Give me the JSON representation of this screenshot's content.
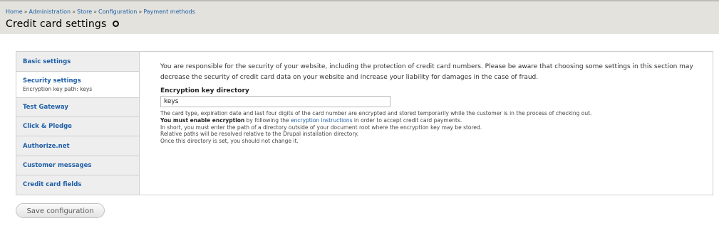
{
  "breadcrumb": {
    "items": [
      "Home",
      "Administration",
      "Store",
      "Configuration",
      "Payment methods"
    ],
    "separator": "»"
  },
  "page": {
    "title": "Credit card settings",
    "title_icon": "gear-icon"
  },
  "vertical_tabs": [
    {
      "label": "Basic settings",
      "summary": ""
    },
    {
      "label": "Security settings",
      "summary": "Encryption key path: keys",
      "active": true
    },
    {
      "label": "Test Gateway",
      "summary": ""
    },
    {
      "label": "Click & Pledge",
      "summary": ""
    },
    {
      "label": "Authorize.net",
      "summary": ""
    },
    {
      "label": "Customer messages",
      "summary": ""
    },
    {
      "label": "Credit card fields",
      "summary": ""
    }
  ],
  "security": {
    "intro": "You are responsible for the security of your website, including the protection of credit card numbers. Please be aware that choosing some settings in this section may decrease the security of credit card data on your website and increase your liability for damages in the case of fraud.",
    "field_label": "Encryption key directory",
    "field_value": "keys",
    "desc_line1": "The card type, expiration date and last four digits of the card number are encrypted and stored temporarily while the customer is in the process of checking out.",
    "desc_strong": "You must enable encryption",
    "desc_mid": " by following the ",
    "desc_link": "encryption instructions",
    "desc_end": " in order to accept credit card payments.",
    "desc_line3": "In short, you must enter the path of a directory outside of your document root where the encryption key may be stored.",
    "desc_line4": "Relative paths will be resolved relative to the Drupal installation directory.",
    "desc_line5": "Once this directory is set, you should not change it."
  },
  "actions": {
    "save_label": "Save configuration"
  },
  "colors": {
    "link": "#1f5fa7",
    "header_bg": "#e3e2dc",
    "tabs_bg": "#eeeeee"
  }
}
